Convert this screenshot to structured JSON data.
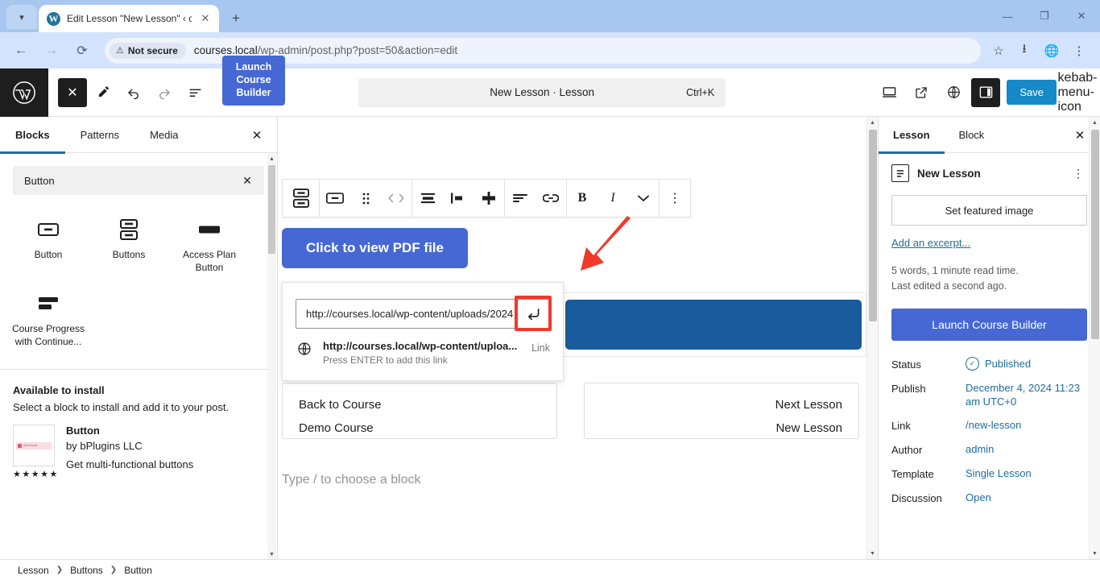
{
  "browser": {
    "tab": {
      "title": "Edit Lesson \"New Lesson\" ‹ cou",
      "favicon": "wordpress-icon",
      "close_label": "✕"
    },
    "new_tab_label": "+",
    "tabstrip_arrow": "▾",
    "window_controls": {
      "minimize": "—",
      "maximize": "❐",
      "close": "✕"
    },
    "nav": {
      "back": "←",
      "forward": "→",
      "reload": "⟳"
    },
    "omnibox": {
      "security_label": "Not secure",
      "security_icon": "warning-triangle-icon",
      "url_host": "courses.local",
      "url_path": "/wp-admin/post.php?post=50&action=edit",
      "bookmark_icon": "star-icon"
    },
    "toolbar_icons": {
      "downloads": "download-icon",
      "extension": "globe-shield-icon",
      "menu": "kebab-menu-icon"
    }
  },
  "editor_header": {
    "logo": "wordpress-logo",
    "tools": {
      "close_inserter": "✕",
      "edit_mode": "pencil-icon",
      "undo": "undo-icon",
      "redo": "redo-icon",
      "list_view": "document-outline-icon"
    },
    "course_builder_badge": "Launch Course Builder",
    "document_title": "New Lesson · Lesson",
    "document_shortcut": "Ctrl+K",
    "right_tools": {
      "preview": "desktop-preview-icon",
      "view_site": "external-link-icon",
      "plugin": "rocket-globe-icon",
      "settings_panel": "sidebar-toggle-icon",
      "options": "kebab-menu-icon"
    },
    "save_label": "Save",
    "save_color": "#1689c8"
  },
  "inserter": {
    "tabs": [
      {
        "label": "Blocks",
        "active": true
      },
      {
        "label": "Patterns",
        "active": false
      },
      {
        "label": "Media",
        "active": false
      }
    ],
    "close_label": "✕",
    "search": {
      "value": "Button",
      "placeholder": "Search",
      "clear_label": "✕"
    },
    "blocks": [
      {
        "label": "Button",
        "icon": "button-block-icon"
      },
      {
        "label": "Buttons",
        "icon": "buttons-block-icon"
      },
      {
        "label": "Access Plan Button",
        "icon": "access-plan-button-icon"
      },
      {
        "label": "Course Progress with Continue...",
        "icon": "course-progress-icon"
      }
    ],
    "available_title": "Available to install",
    "available_subtitle": "Select a block to install and add it to your post.",
    "plugin": {
      "name": "Button",
      "author": "by bPlugins LLC",
      "description": "Get multi-functional buttons",
      "rating": "★★★★★",
      "thumb_text": "Get in touch"
    }
  },
  "canvas": {
    "block_toolbar": {
      "parent_block": "buttons-block-icon",
      "buttons": [
        {
          "name": "block-type-button",
          "glyph": "▭"
        },
        {
          "name": "drag-handle",
          "glyph": "⠿"
        },
        {
          "name": "move-updown",
          "glyph": "‹ ›"
        },
        {
          "name": "align-wide",
          "glyph": "≡"
        },
        {
          "name": "align-left-inline",
          "glyph": "▐▬"
        },
        {
          "name": "align-center-vertical",
          "glyph": "✛"
        },
        {
          "name": "text-align",
          "glyph": "≡"
        },
        {
          "name": "link",
          "glyph": "⊂⊃"
        },
        {
          "name": "bold",
          "glyph": "B"
        },
        {
          "name": "italic",
          "glyph": "I"
        },
        {
          "name": "more-formatting",
          "glyph": "⌄"
        },
        {
          "name": "options",
          "glyph": "⋮"
        }
      ]
    },
    "pdf_button_label": "Click to view PDF file",
    "pdf_button_color": "#4668d4",
    "blue_block_color": "#195b9c",
    "link_popover": {
      "url_value": "http://courses.local/wp-content/uploads/2024",
      "submit_icon": "submit-enter-icon",
      "highlight_color": "#f0392b",
      "suggestion_url": "http://courses.local/wp-content/uploa...",
      "suggestion_hint": "Press ENTER to add this link",
      "suggestion_kind": "Link",
      "suggestion_icon": "globe-icon"
    },
    "nav_cards": [
      {
        "line1": "Back to Course",
        "line2": "Demo Course",
        "align": "left"
      },
      {
        "line1": "Next Lesson",
        "line2": "New Lesson",
        "align": "right"
      }
    ],
    "placeholder": "Type / to choose a block"
  },
  "sidebar": {
    "tabs": [
      {
        "label": "Lesson",
        "active": true
      },
      {
        "label": "Block",
        "active": false
      }
    ],
    "close_label": "✕",
    "doc_title": "New Lesson",
    "doc_icon": "lesson-document-icon",
    "kebab": "⋮",
    "featured_image_label": "Set featured image",
    "excerpt_link": "Add an excerpt...",
    "word_count": "5 words, 1 minute read time.",
    "last_edited": "Last edited a second ago.",
    "builder_button": "Launch Course Builder",
    "builder_color": "#4668d4",
    "rows": [
      {
        "label": "Status",
        "value": "Published",
        "icon": "check-circle-icon"
      },
      {
        "label": "Publish",
        "value": "December 4, 2024 11:23 am UTC+0"
      },
      {
        "label": "Link",
        "value": "/new-lesson"
      },
      {
        "label": "Author",
        "value": "admin"
      },
      {
        "label": "Template",
        "value": "Single Lesson"
      },
      {
        "label": "Discussion",
        "value": "Open"
      }
    ]
  },
  "footer": {
    "breadcrumb": [
      "Lesson",
      "Buttons",
      "Button"
    ],
    "separator": "❯"
  }
}
